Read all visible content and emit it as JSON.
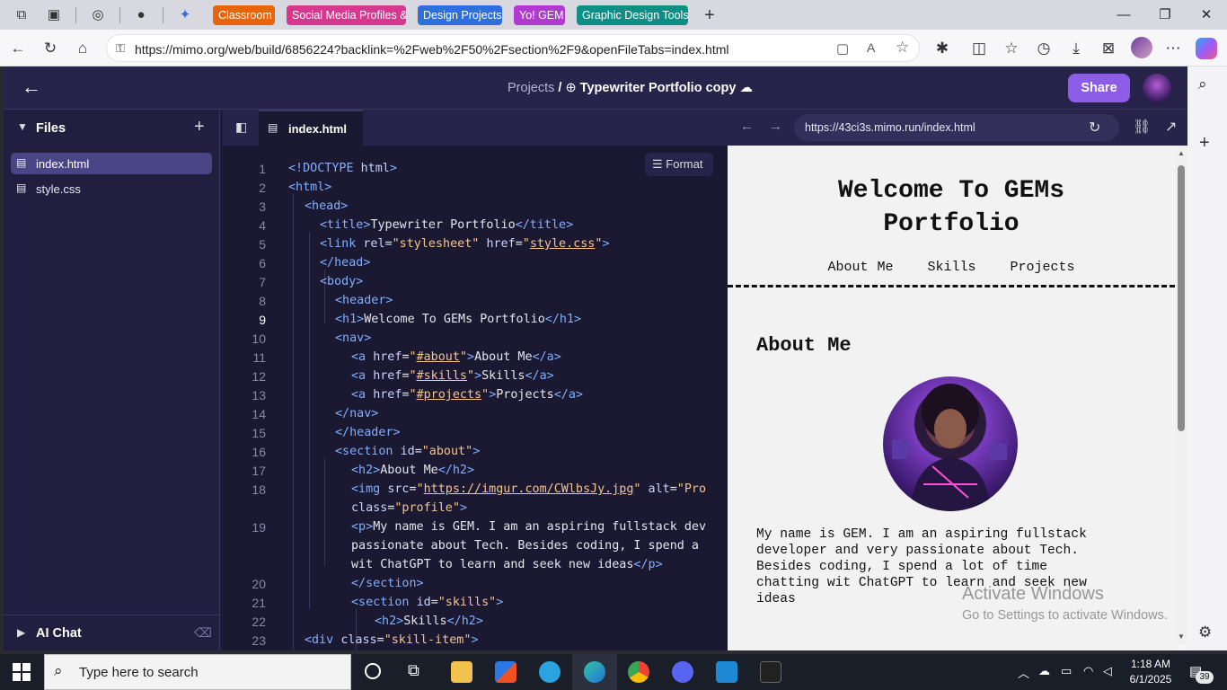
{
  "browser": {
    "tabs": [
      {
        "label": "Classroom",
        "color": "#e8630a"
      },
      {
        "label": "Social Media Profiles &",
        "color": "#d6388f"
      },
      {
        "label": "Design Projects",
        "color": "#2f6ee0"
      },
      {
        "label": "Yo! GEM",
        "color": "#b23ad0"
      },
      {
        "label": "Graphic Design Tools",
        "color": "#0e8f86"
      }
    ],
    "url": "https://mimo.org/web/build/6856224?backlink=%2Fweb%2F50%2Fsection%2F9&openFileTabs=index.html"
  },
  "app": {
    "breadcrumb_root": "Projects",
    "breadcrumb_sep": "/",
    "project_title": "Typewriter Portfolio copy",
    "share_label": "Share"
  },
  "files": {
    "heading": "Files",
    "items": [
      "index.html",
      "style.css"
    ],
    "ai_chat": "AI Chat"
  },
  "editor": {
    "tab": "index.html",
    "format_label": "Format"
  },
  "preview": {
    "url": "https://43ci3s.mimo.run/index.html",
    "title_line1": "Welcome To GEMs",
    "title_line2": "Portfolio",
    "nav": [
      "About Me",
      "Skills",
      "Projects"
    ],
    "section_heading": "About Me",
    "paragraph_lines": [
      "My name is GEM. I am an aspiring fullstack",
      "developer and very passionate about Tech.",
      "Besides coding, I spend a lot of time",
      "chatting wit ChatGPT to learn and seek new",
      "ideas"
    ],
    "watermark_title": "Activate Windows",
    "watermark_sub": "Go to Settings to activate Windows."
  },
  "taskbar": {
    "search_placeholder": "Type here to search",
    "time": "1:18 AM",
    "date": "6/1/2025",
    "notifications": "39"
  },
  "colors": {
    "app_bg": "#1f1c3a",
    "share_button": "#8e5de8",
    "code_tag": "#7fb0ff",
    "code_string": "#f6c48d"
  }
}
